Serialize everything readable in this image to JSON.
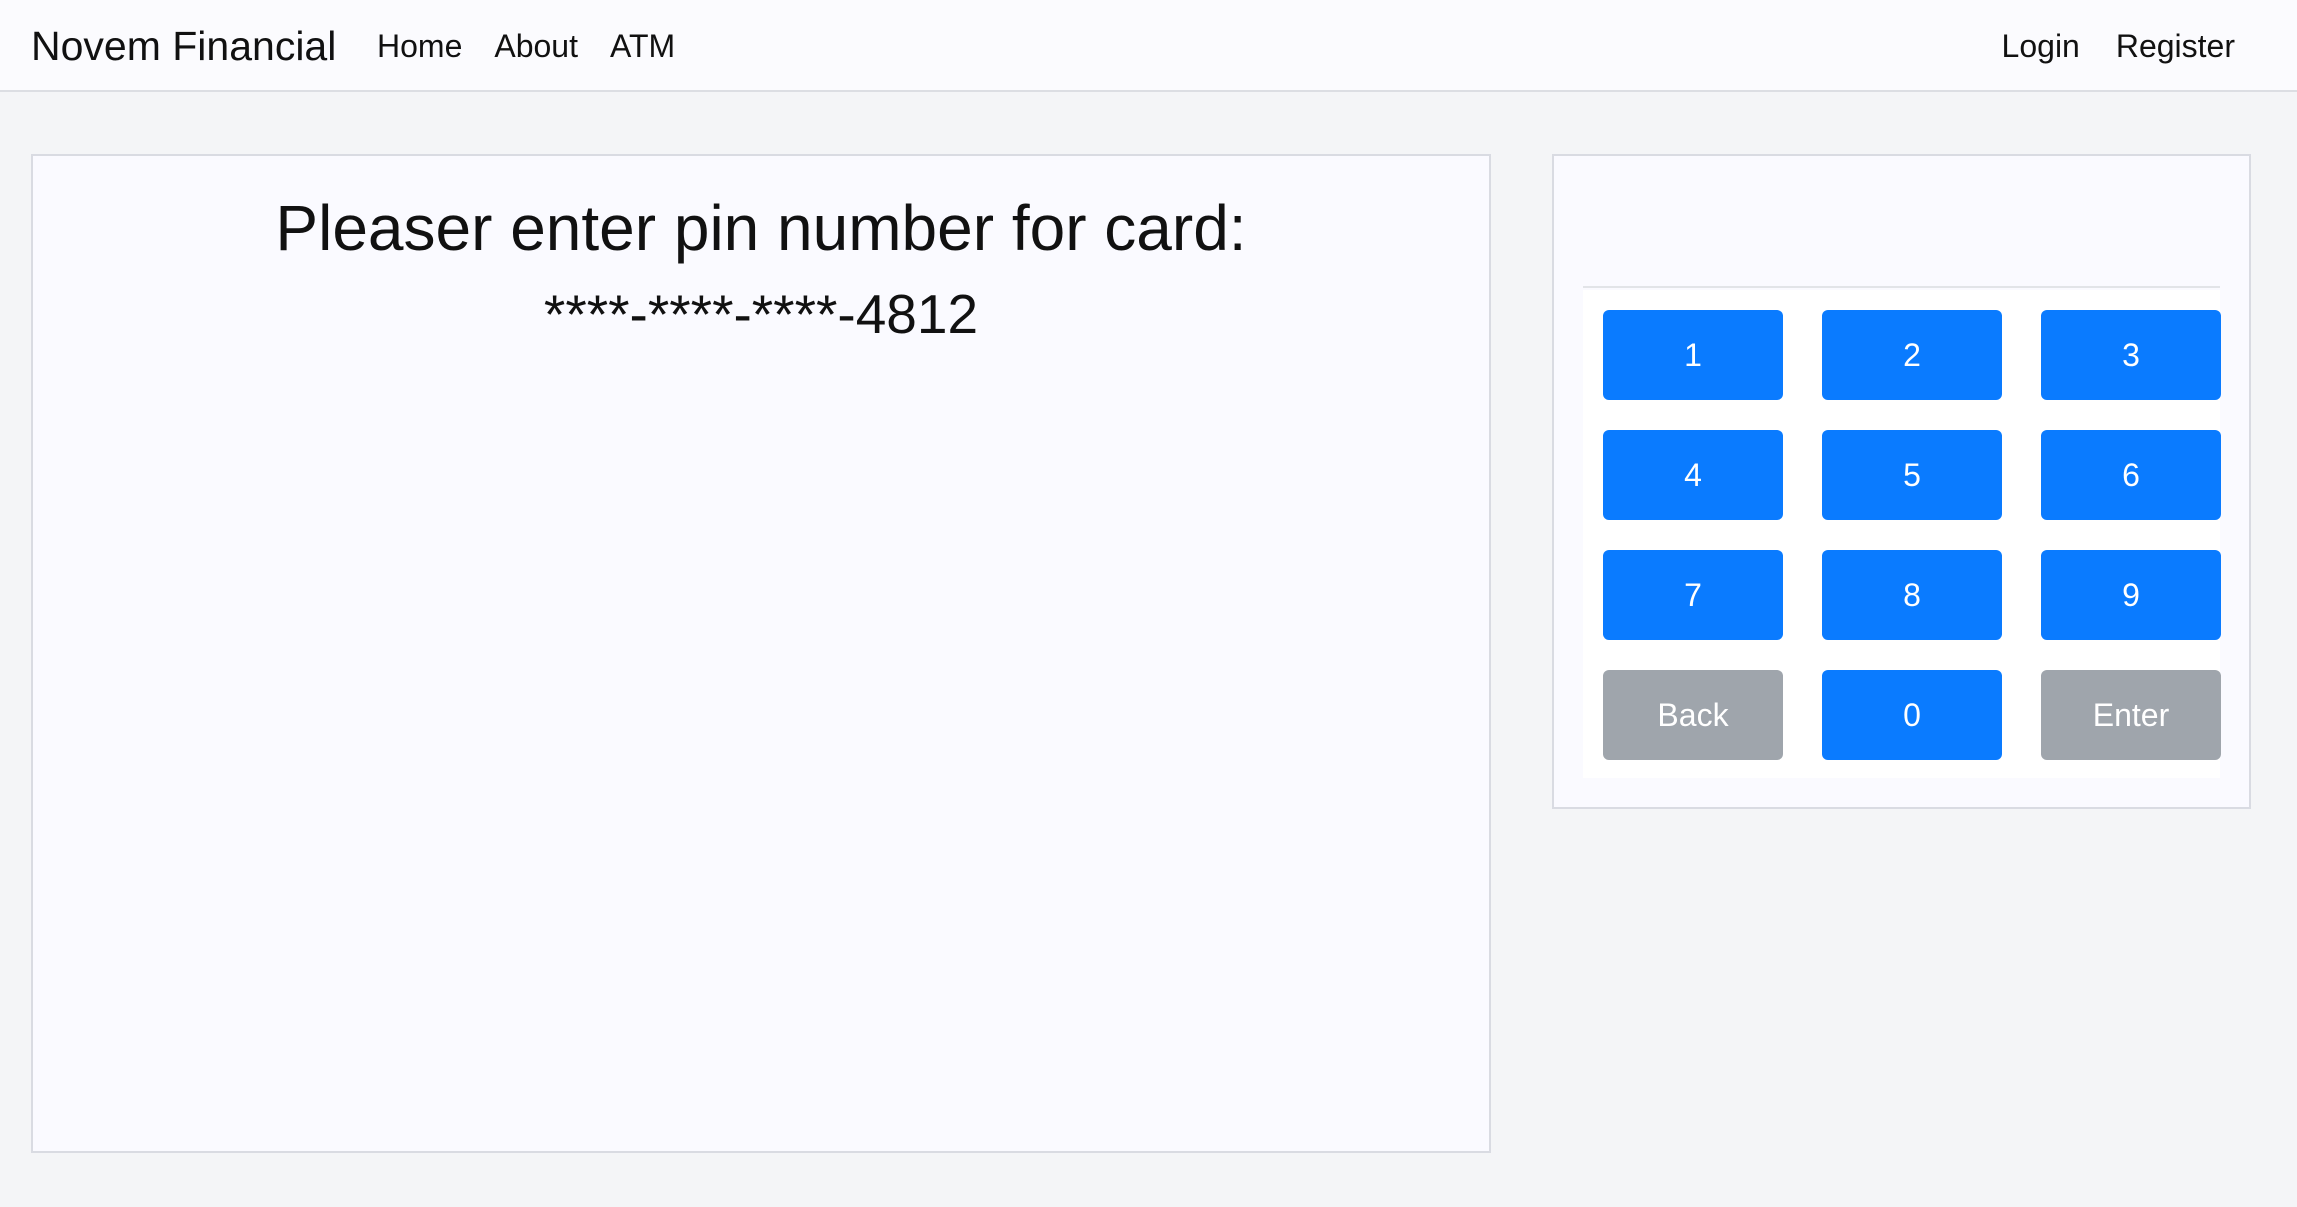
{
  "navbar": {
    "brand": "Novem Financial",
    "left_links": [
      "Home",
      "About",
      "ATM"
    ],
    "right_links": [
      "Login",
      "Register"
    ]
  },
  "screen": {
    "prompt": "Pleaser enter pin number for card:",
    "card_number": "****-****-****-4812"
  },
  "keypad": {
    "pin_value": "",
    "keys": {
      "k1": "1",
      "k2": "2",
      "k3": "3",
      "k4": "4",
      "k5": "5",
      "k6": "6",
      "k7": "7",
      "k8": "8",
      "k9": "9",
      "back": "Back",
      "k0": "0",
      "enter": "Enter"
    }
  },
  "colors": {
    "primary_button": "#0a7bff",
    "secondary_button": "#9fa5ac",
    "page_background": "#f4f5f7"
  }
}
